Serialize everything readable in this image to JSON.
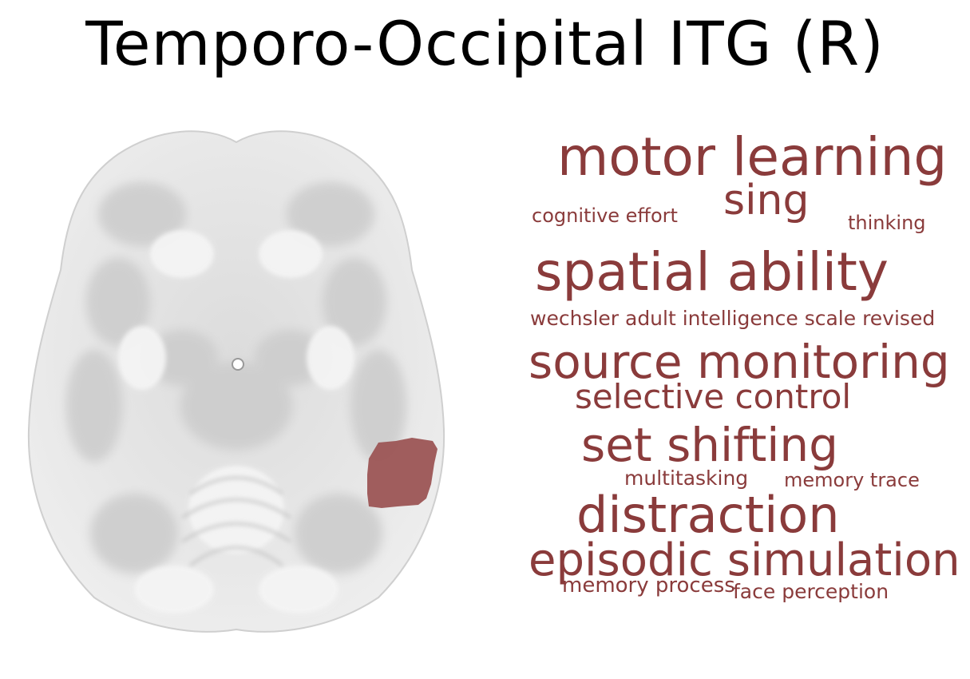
{
  "title": "Temporo-Occipital ITG (R)",
  "colors": {
    "accent": "#8a3b3b",
    "region_highlight": "#9c5555",
    "brain_tissue": "#e9e9e9",
    "background": "#ffffff"
  },
  "word_cloud": [
    {
      "id": "motor-learning",
      "text": "motor learning"
    },
    {
      "id": "sing",
      "text": "sing"
    },
    {
      "id": "cognitive-effort",
      "text": "cognitive effort"
    },
    {
      "id": "thinking",
      "text": "thinking"
    },
    {
      "id": "spatial-ability",
      "text": "spatial ability"
    },
    {
      "id": "wechsler",
      "text": "wechsler adult intelligence scale revised"
    },
    {
      "id": "source-monitoring",
      "text": "source monitoring"
    },
    {
      "id": "selective-control",
      "text": "selective control"
    },
    {
      "id": "set-shifting",
      "text": "set shifting"
    },
    {
      "id": "multitasking",
      "text": "multitasking"
    },
    {
      "id": "memory-trace",
      "text": "memory trace"
    },
    {
      "id": "distraction",
      "text": "distraction"
    },
    {
      "id": "episodic-simulation",
      "text": "episodic simulation"
    },
    {
      "id": "memory-process",
      "text": "memory process"
    },
    {
      "id": "face-perception",
      "text": "face perception"
    }
  ]
}
